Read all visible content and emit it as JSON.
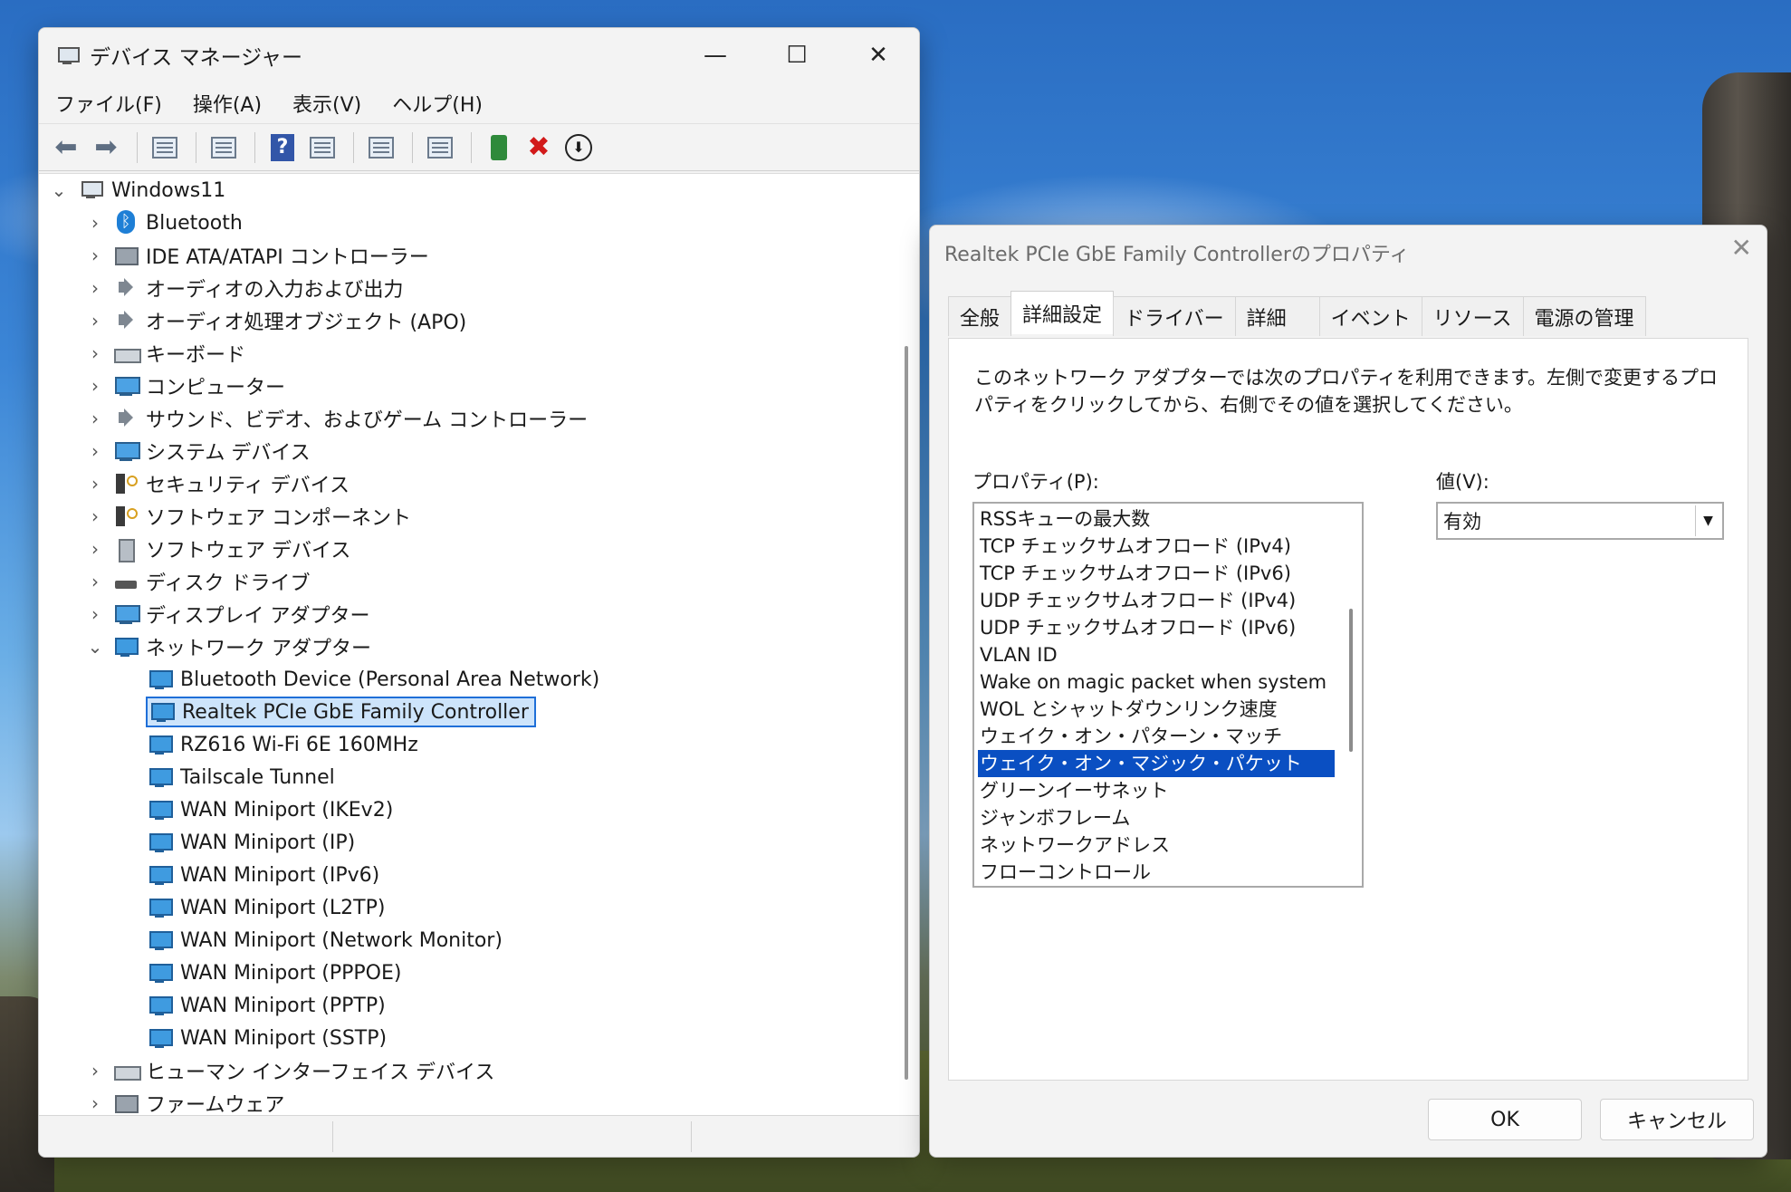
{
  "device_manager": {
    "title": "デバイス マネージャー",
    "controls": {
      "minimize": "—",
      "maximize": "☐",
      "close": "✕"
    },
    "menu": [
      "ファイル(F)",
      "操作(A)",
      "表示(V)",
      "ヘルプ(H)"
    ],
    "tree": {
      "root": "Windows11",
      "categories": [
        {
          "label": "Bluetooth",
          "icon": "bluetooth-icon"
        },
        {
          "label": "IDE ATA/ATAPI コントローラー",
          "icon": "controller-icon"
        },
        {
          "label": "オーディオの入力および出力",
          "icon": "speaker-icon"
        },
        {
          "label": "オーディオ処理オブジェクト (APO)",
          "icon": "speaker-icon"
        },
        {
          "label": "キーボード",
          "icon": "keyboard-icon"
        },
        {
          "label": "コンピューター",
          "icon": "computer-icon"
        },
        {
          "label": "サウンド、ビデオ、およびゲーム コントローラー",
          "icon": "speaker-icon"
        },
        {
          "label": "システム デバイス",
          "icon": "computer-icon"
        },
        {
          "label": "セキュリティ デバイス",
          "icon": "security-icon"
        },
        {
          "label": "ソフトウェア コンポーネント",
          "icon": "security-icon"
        },
        {
          "label": "ソフトウェア デバイス",
          "icon": "software-icon"
        },
        {
          "label": "ディスク ドライブ",
          "icon": "disk-icon"
        },
        {
          "label": "ディスプレイ アダプター",
          "icon": "computer-icon"
        },
        {
          "label": "ネットワーク アダプター",
          "icon": "network-icon"
        }
      ],
      "network_adapters": [
        "Bluetooth Device (Personal Area Network)",
        "Realtek PCIe GbE Family Controller",
        "RZ616 Wi-Fi 6E 160MHz",
        "Tailscale Tunnel",
        "WAN Miniport (IKEv2)",
        "WAN Miniport (IP)",
        "WAN Miniport (IPv6)",
        "WAN Miniport (L2TP)",
        "WAN Miniport (Network Monitor)",
        "WAN Miniport (PPPOE)",
        "WAN Miniport (PPTP)",
        "WAN Miniport (SSTP)"
      ],
      "after": [
        {
          "label": "ヒューマン インターフェイス デバイス",
          "icon": "hid-icon"
        },
        {
          "label": "ファームウェア",
          "icon": "firmware-icon"
        }
      ]
    }
  },
  "properties_dialog": {
    "title": "Realtek PCIe GbE Family Controllerのプロパティ",
    "close": "✕",
    "tabs": [
      "全般",
      "詳細設定",
      "ドライバー",
      "詳細",
      "イベント",
      "リソース",
      "電源の管理"
    ],
    "active_tab": "詳細設定",
    "description": "このネットワーク アダプターでは次のプロパティを利用できます。左側で変更するプロパティをクリックしてから、右側でその値を選択してください。",
    "property_label": "プロパティ(P):",
    "value_label": "値(V):",
    "properties": [
      "RSSキューの最大数",
      "TCP チェックサムオフロード (IPv4)",
      "TCP チェックサムオフロード (IPv6)",
      "UDP チェックサムオフロード (IPv4)",
      "UDP チェックサムオフロード (IPv6)",
      "VLAN ID",
      "Wake on magic packet when system",
      "WOL とシャットダウンリンク速度",
      "ウェイク・オン・パターン・マッチ",
      "ウェイク・オン・マジック・パケット",
      "グリーンイーサネット",
      "ジャンボフレーム",
      "ネットワークアドレス",
      "フローコントロール"
    ],
    "selected_property": "ウェイク・オン・マジック・パケット",
    "value": "有効",
    "ok": "OK",
    "cancel": "キャンセル"
  }
}
